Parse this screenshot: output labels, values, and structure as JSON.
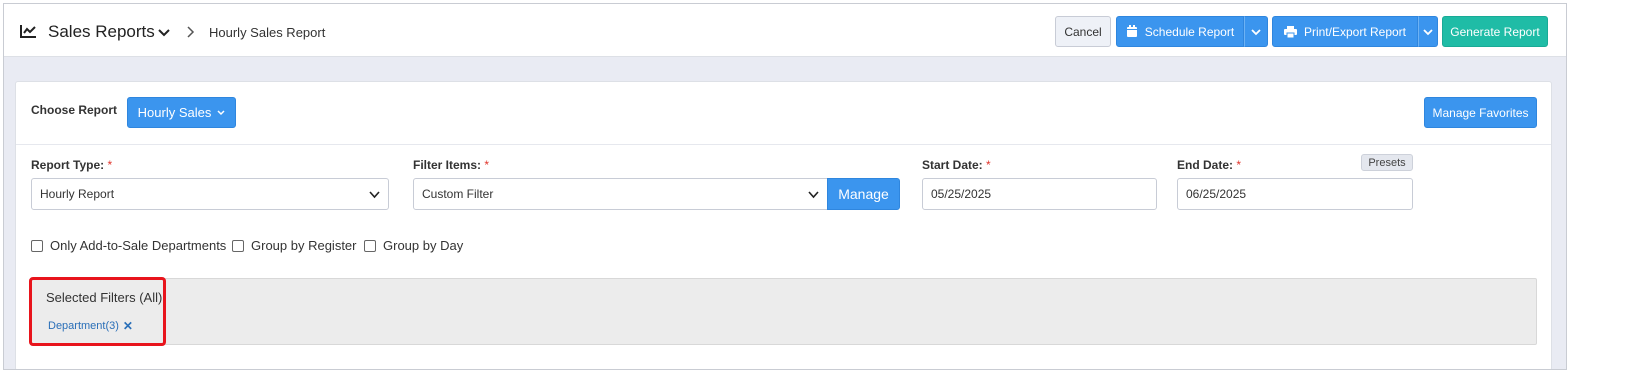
{
  "header": {
    "title": "Sales Reports",
    "breadcrumb_current": "Hourly Sales Report",
    "cancel_label": "Cancel",
    "schedule_label": "Schedule Report",
    "print_label": "Print/Export Report",
    "generate_label": "Generate Report"
  },
  "panel": {
    "choose_report_label": "Choose Report",
    "report_selector": "Hourly Sales",
    "manage_favorites_label": "Manage Favorites",
    "report_type": {
      "label": "Report Type:",
      "required": "*",
      "value": "Hourly Report"
    },
    "filter_items": {
      "label": "Filter Items:",
      "required": "*",
      "value": "Custom Filter",
      "manage_label": "Manage"
    },
    "start_date": {
      "label": "Start Date:",
      "required": "*",
      "value": "05/25/2025"
    },
    "end_date": {
      "label": "End Date:",
      "required": "*",
      "value": "06/25/2025",
      "presets_label": "Presets"
    },
    "options": [
      {
        "label": "Only Add-to-Sale Departments",
        "checked": false
      },
      {
        "label": "Group by Register",
        "checked": false
      },
      {
        "label": "Group by Day",
        "checked": false
      }
    ],
    "selected_filters": {
      "title": "Selected Filters (All)",
      "tags": [
        {
          "label": "Department(3)",
          "remove_icon": "close-x-icon"
        }
      ]
    }
  },
  "colors": {
    "primary": "#3b95ee",
    "success": "#1fbca6",
    "required": "#e0342b",
    "highlight": "#e8141c"
  }
}
